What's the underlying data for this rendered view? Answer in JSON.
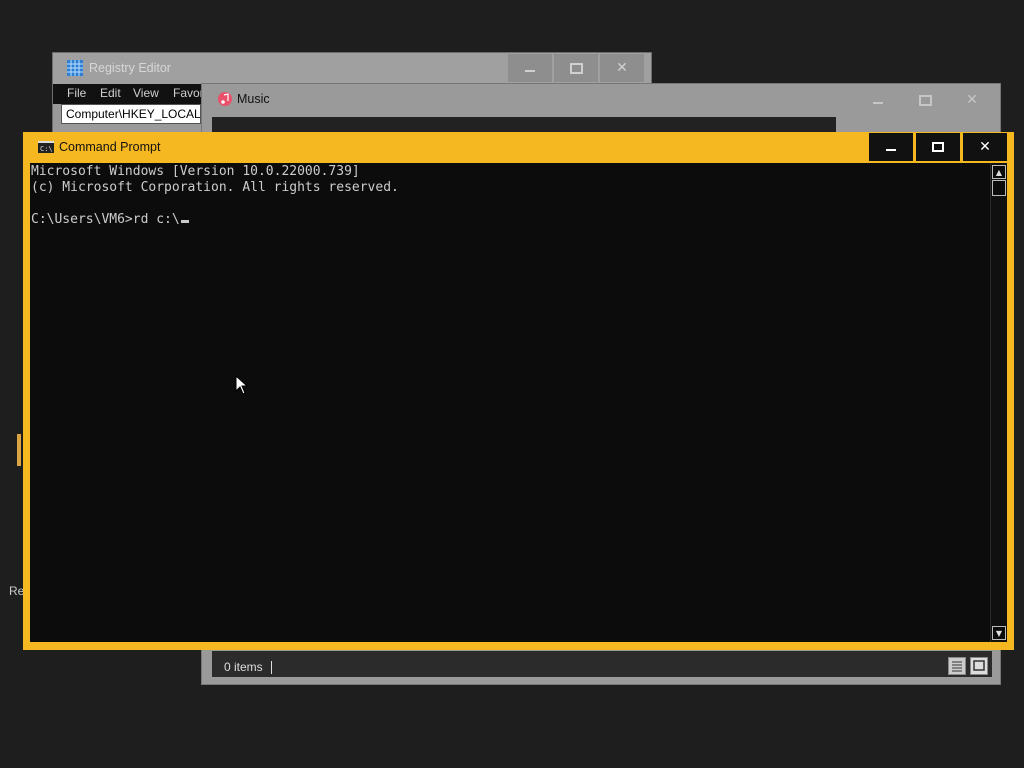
{
  "registry_editor": {
    "title": "Registry Editor",
    "menu": [
      "File",
      "Edit",
      "View",
      "Favor"
    ],
    "address": "Computer\\HKEY_LOCAL_"
  },
  "music": {
    "title": "Music",
    "status": "0 items"
  },
  "cmd": {
    "title": "Command Prompt",
    "lines": [
      "Microsoft Windows [Version 10.0.22000.739]",
      "(c) Microsoft Corporation. All rights reserved.",
      "",
      "C:\\Users\\VM6>rd c:\\"
    ]
  },
  "desktop": {
    "partial_label": "Re"
  },
  "colors": {
    "accent": "#f6b820",
    "console_bg": "#0c0c0c",
    "console_fg": "#cccccc"
  }
}
